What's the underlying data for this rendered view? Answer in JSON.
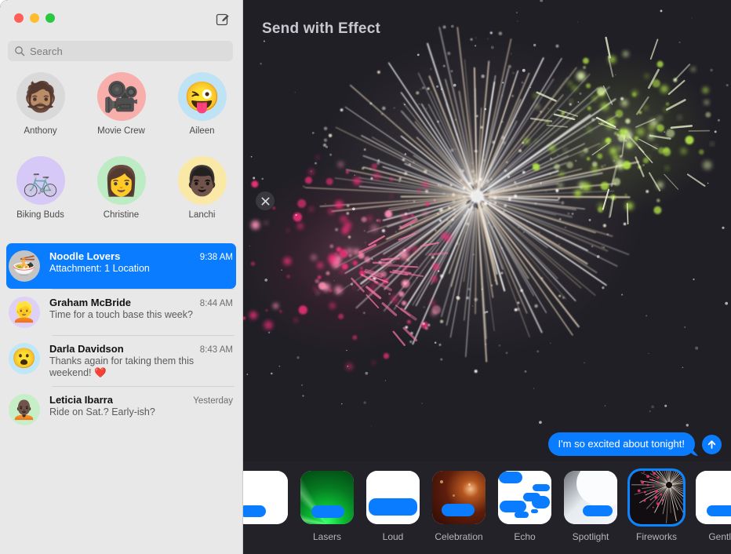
{
  "window": {
    "traffic_lights": [
      {
        "name": "close",
        "color": "#ff5f57"
      },
      {
        "name": "minimize",
        "color": "#febc2e"
      },
      {
        "name": "maximize",
        "color": "#28c840"
      }
    ]
  },
  "sidebar": {
    "compose_icon": "compose-icon",
    "search": {
      "placeholder": "Search",
      "value": "",
      "icon": "search-icon"
    },
    "pinned": [
      {
        "label": "Anthony",
        "glyph": "🧔🏽",
        "bg": "#d9d9d9"
      },
      {
        "label": "Movie Crew",
        "glyph": "🎥",
        "bg": "#f8aeab"
      },
      {
        "label": "Aileen",
        "glyph": "😜",
        "bg": "#bee3f5"
      },
      {
        "label": "Biking Buds",
        "glyph": "🚲",
        "bg": "#d7c9f7"
      },
      {
        "label": "Christine",
        "glyph": "👩",
        "bg": "#bdecc4"
      },
      {
        "label": "Lanchi",
        "glyph": "👨🏿",
        "bg": "#fae9a6"
      }
    ],
    "conversations": [
      {
        "name": "Noodle Lovers",
        "time": "9:38 AM",
        "preview": "Attachment: 1 Location",
        "glyph": "🍜",
        "bg": "#c4c4c4",
        "selected": true
      },
      {
        "name": "Graham McBride",
        "time": "8:44 AM",
        "preview": "Time for a touch base this week?",
        "glyph": "👱",
        "bg": "#ded0f7",
        "selected": false
      },
      {
        "name": "Darla Davidson",
        "time": "8:43 AM",
        "preview": "Thanks again for taking them this weekend! ❤️",
        "glyph": "😮",
        "bg": "#bfe7f7",
        "selected": false
      },
      {
        "name": "Leticia Ibarra",
        "time": "Yesterday",
        "preview": "Ride on Sat.? Early-ish?",
        "glyph": "🧑🏿‍🦲",
        "bg": "#c6efc8",
        "selected": false
      }
    ]
  },
  "main": {
    "title": "Send with Effect",
    "close_icon": "close-icon",
    "message": {
      "text": "I'm so excited about tonight!",
      "bubble_color": "#0a7cff"
    },
    "send_button": {
      "icon": "arrow-up-icon",
      "color": "#0a7cff"
    },
    "preview_effect": "Fireworks",
    "accent_color": "#0a84ff",
    "background_color": "#211f26",
    "effects": [
      {
        "label": "",
        "kind": "partial",
        "selected": false
      },
      {
        "label": "Lasers",
        "kind": "lasers",
        "selected": false
      },
      {
        "label": "Loud",
        "kind": "loud",
        "selected": false
      },
      {
        "label": "Celebration",
        "kind": "celebration",
        "selected": false
      },
      {
        "label": "Echo",
        "kind": "echo",
        "selected": false
      },
      {
        "label": "Spotlight",
        "kind": "spotlight",
        "selected": false
      },
      {
        "label": "Fireworks",
        "kind": "fireworks",
        "selected": true
      },
      {
        "label": "Gentle",
        "kind": "gentle",
        "selected": false
      }
    ]
  }
}
